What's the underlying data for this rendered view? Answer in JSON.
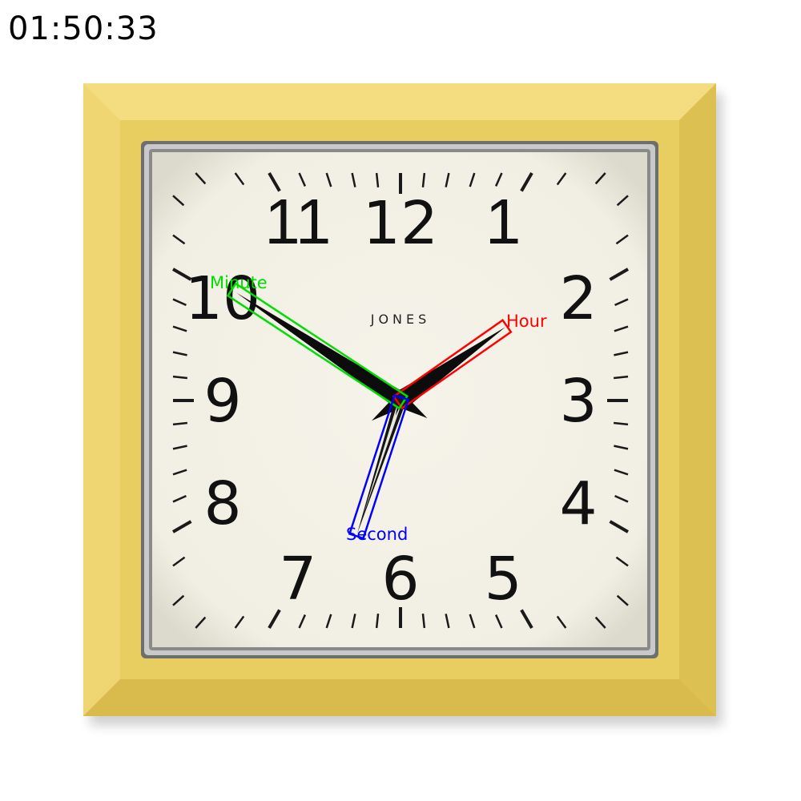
{
  "time_readout": "01:50:33",
  "clock": {
    "brand": "JONES",
    "numerals": [
      "12",
      "1",
      "2",
      "3",
      "4",
      "5",
      "6",
      "7",
      "8",
      "9",
      "10",
      "11"
    ],
    "time": {
      "hours": 1,
      "minutes": 50,
      "seconds": 33
    },
    "frame_color": "#ecd36a",
    "face_color": "#f3f1e6"
  },
  "annotations": {
    "hour": {
      "label": "Hour",
      "color": "#ff0000"
    },
    "minute": {
      "label": "Minute",
      "color": "#00dd00"
    },
    "second": {
      "label": "Second",
      "color": "#0000ff"
    }
  }
}
